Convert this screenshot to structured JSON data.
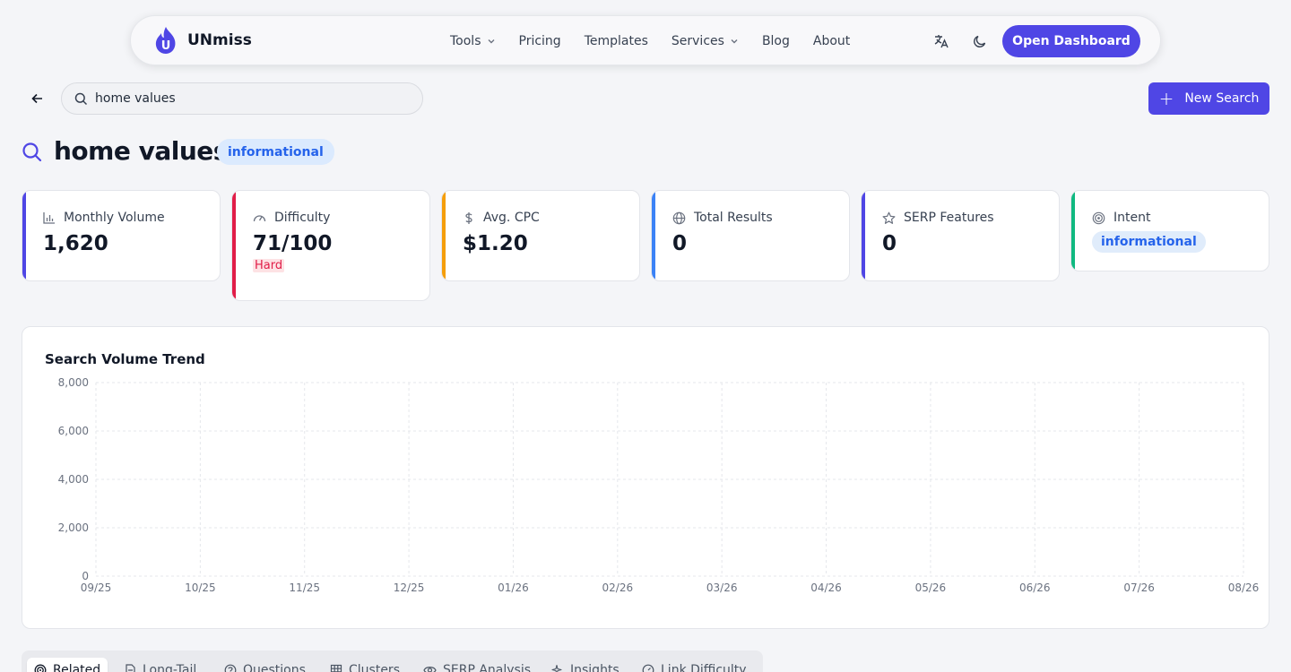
{
  "brand": {
    "name": "UNmiss",
    "logo_letter": "U",
    "accent": "#4f46e5"
  },
  "nav": {
    "links": [
      "Tools",
      "Pricing",
      "Templates",
      "Services",
      "Blog",
      "About"
    ],
    "cta": "Open Dashboard",
    "icons": [
      "translate-icon",
      "moon-icon"
    ]
  },
  "search": {
    "value": "home values",
    "new_search_label": "New Search"
  },
  "keyword": {
    "title": "home values",
    "intent_badge": "informational"
  },
  "cards": [
    {
      "label": "Monthly Volume",
      "value": "1,620",
      "icon": "bar-chart-icon",
      "accent": "#4f46e5"
    },
    {
      "label": "Difficulty",
      "value": "71/100",
      "sub": "Hard",
      "icon": "gauge-icon",
      "accent": "#e11d48"
    },
    {
      "label": "Avg. CPC",
      "value": "$1.20",
      "icon": "dollar-icon",
      "accent": "#f59e0b"
    },
    {
      "label": "Total Results",
      "value": "0",
      "icon": "globe-icon",
      "accent": "#3b82f6"
    },
    {
      "label": "SERP Features",
      "value": "0",
      "icon": "star-icon",
      "accent": "#4f46e5"
    },
    {
      "label": "Intent",
      "value": "informational",
      "icon": "target-icon",
      "accent": "#10b981"
    }
  ],
  "chart_data": {
    "type": "line",
    "title": "Search Volume Trend",
    "categories": [
      "09/25",
      "10/25",
      "11/25",
      "12/25",
      "01/26",
      "02/26",
      "03/26",
      "04/26",
      "05/26",
      "06/26",
      "07/26",
      "08/26"
    ],
    "y_ticks": [
      "0",
      "2,000",
      "4,000",
      "6,000",
      "8,000"
    ],
    "ylim": [
      0,
      8000
    ],
    "grid": true,
    "series": []
  },
  "tabs": [
    {
      "label": "Related",
      "icon": "target-icon",
      "active": true
    },
    {
      "label": "Long-Tail",
      "icon": "document-icon"
    },
    {
      "label": "Questions",
      "icon": "question-icon"
    },
    {
      "label": "Clusters",
      "icon": "grid-icon"
    },
    {
      "label": "SERP Analysis",
      "icon": "eye-icon"
    },
    {
      "label": "Insights",
      "icon": "sparkle-icon"
    },
    {
      "label": "Link Difficulty",
      "icon": "gauge-icon"
    }
  ]
}
